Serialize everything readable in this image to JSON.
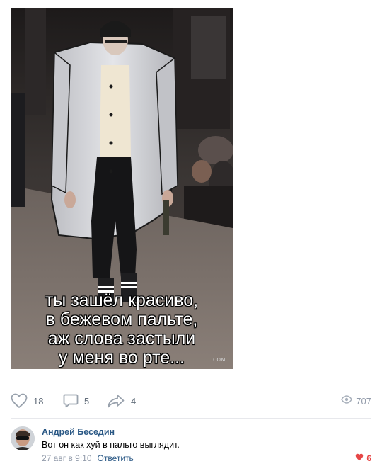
{
  "post": {
    "image": {
      "caption_lines": [
        "ты зашёл красиво,",
        "в бежевом пальте,",
        "аж слова застыли",
        "у меня во рте..."
      ],
      "watermark": "COM"
    },
    "actions": {
      "like_count": "18",
      "comment_count": "5",
      "share_count": "4",
      "views_count": "707",
      "like_icon": "heart-outline-icon",
      "comment_icon": "speech-bubble-icon",
      "share_icon": "share-arrow-icon",
      "views_icon": "eye-icon"
    }
  },
  "comment": {
    "author": "Андрей Беседин",
    "text": "Вот он как хуй в пальто выглядит.",
    "date": "27 авг в 9:10",
    "reply_label": "Ответить",
    "like_count": "6",
    "like_icon": "heart-filled-icon"
  },
  "colors": {
    "link": "#2a5885",
    "muted": "#939cab",
    "action_icon": "#99a2ad",
    "divider": "#e7e8ec",
    "like_active": "#e64646"
  }
}
